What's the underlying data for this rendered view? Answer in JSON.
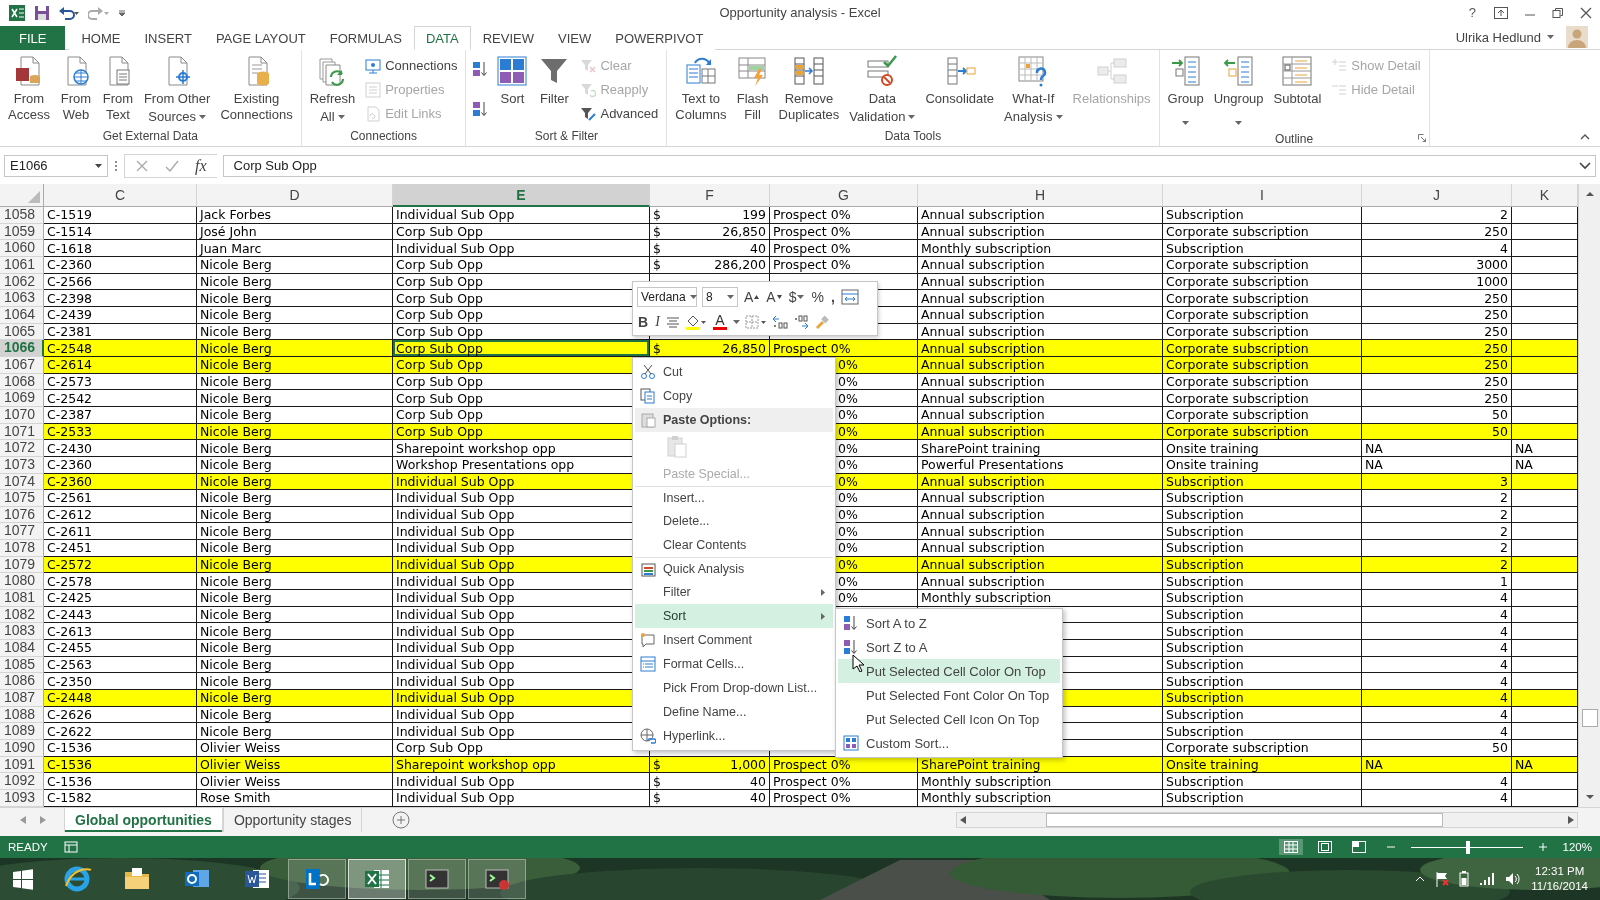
{
  "title_bar": {
    "title": "Opportunity analysis - Excel",
    "help": "?"
  },
  "ribbon_tabs": [
    {
      "label": "FILE",
      "kind": "file",
      "selected": false
    },
    {
      "label": "HOME",
      "kind": "tab",
      "selected": false
    },
    {
      "label": "INSERT",
      "kind": "tab",
      "selected": false
    },
    {
      "label": "PAGE LAYOUT",
      "kind": "tab",
      "selected": false
    },
    {
      "label": "FORMULAS",
      "kind": "tab",
      "selected": false
    },
    {
      "label": "DATA",
      "kind": "tab",
      "selected": true
    },
    {
      "label": "REVIEW",
      "kind": "tab",
      "selected": false
    },
    {
      "label": "VIEW",
      "kind": "tab",
      "selected": false
    },
    {
      "label": "POWERPIVOT",
      "kind": "tab",
      "selected": false
    }
  ],
  "account": {
    "name": "Ulrika Hedlund"
  },
  "ribbon_groups": [
    {
      "label": "Get External Data",
      "buttons": [
        {
          "kind": "large",
          "label": "From\nAccess",
          "dropdown": false,
          "disabled": false
        },
        {
          "kind": "large",
          "label": "From\nWeb",
          "dropdown": false,
          "disabled": false
        },
        {
          "kind": "large",
          "label": "From\nText",
          "dropdown": false,
          "disabled": false
        },
        {
          "kind": "large",
          "label": "From Other\nSources",
          "dropdown": true,
          "disabled": false
        },
        {
          "kind": "large",
          "label": "Existing\nConnections",
          "dropdown": false,
          "disabled": false
        }
      ]
    },
    {
      "label": "Connections",
      "buttons": [
        {
          "kind": "large",
          "label": "Refresh\nAll",
          "dropdown": true,
          "disabled": false
        },
        {
          "kind": "small",
          "label": "Connections",
          "dropdown": false,
          "disabled": false
        },
        {
          "kind": "small",
          "label": "Properties",
          "dropdown": false,
          "disabled": true
        },
        {
          "kind": "small",
          "label": "Edit Links",
          "dropdown": false,
          "disabled": true
        }
      ]
    },
    {
      "label": "Sort & Filter",
      "buttons": [
        {
          "kind": "icon",
          "dropdown": false,
          "disabled": false
        },
        {
          "kind": "icon",
          "dropdown": false,
          "disabled": false
        },
        {
          "kind": "large",
          "label": "Sort",
          "dropdown": false,
          "disabled": false
        },
        {
          "kind": "large",
          "label": "Filter",
          "dropdown": false,
          "disabled": false
        },
        {
          "kind": "small",
          "label": "Clear",
          "dropdown": false,
          "disabled": true
        },
        {
          "kind": "small",
          "label": "Reapply",
          "dropdown": false,
          "disabled": true
        },
        {
          "kind": "small",
          "label": "Advanced",
          "dropdown": false,
          "disabled": false
        }
      ]
    },
    {
      "label": "Data Tools",
      "buttons": [
        {
          "kind": "large",
          "label": "Text to\nColumns",
          "dropdown": false,
          "disabled": false
        },
        {
          "kind": "large",
          "label": "Flash\nFill",
          "dropdown": false,
          "disabled": false
        },
        {
          "kind": "large",
          "label": "Remove\nDuplicates",
          "dropdown": false,
          "disabled": false
        },
        {
          "kind": "large",
          "label": "Data\nValidation",
          "dropdown": true,
          "disabled": false
        },
        {
          "kind": "large",
          "label": "Consolidate",
          "dropdown": false,
          "disabled": false
        },
        {
          "kind": "large",
          "label": "What-If\nAnalysis",
          "dropdown": true,
          "disabled": false
        },
        {
          "kind": "large",
          "label": "Relationships",
          "dropdown": false,
          "disabled": true
        }
      ]
    },
    {
      "label": "Outline",
      "launcher": true,
      "buttons": [
        {
          "kind": "large",
          "label": "Group",
          "dropdown": true,
          "disabled": false
        },
        {
          "kind": "large",
          "label": "Ungroup",
          "dropdown": true,
          "disabled": false
        },
        {
          "kind": "large",
          "label": "Subtotal",
          "dropdown": false,
          "disabled": false
        },
        {
          "kind": "small",
          "label": "Show Detail",
          "dropdown": false,
          "disabled": true
        },
        {
          "kind": "small",
          "label": "Hide Detail",
          "dropdown": false,
          "disabled": true
        }
      ]
    }
  ],
  "formula_bar": {
    "name_box": "E1066",
    "function_label": "fx",
    "value": "Corp Sub Opp"
  },
  "columns": [
    {
      "letter": "C",
      "selected": false
    },
    {
      "letter": "D",
      "selected": false
    },
    {
      "letter": "E",
      "selected": true
    },
    {
      "letter": "F",
      "selected": false
    },
    {
      "letter": "G",
      "selected": false
    },
    {
      "letter": "H",
      "selected": false
    },
    {
      "letter": "I",
      "selected": false
    },
    {
      "letter": "J",
      "selected": false
    },
    {
      "letter": "K",
      "selected": false
    }
  ],
  "rows": [
    {
      "number": "1058",
      "selected": false,
      "highlighted": false,
      "cells": [
        "C-1519",
        "Jack Forbes",
        "Individual Sub Opp",
        "$",
        "199",
        "Prospect 0%",
        "Annual subscription",
        "Subscription",
        "2",
        null
      ]
    },
    {
      "number": "1059",
      "selected": false,
      "highlighted": false,
      "cells": [
        "C-1514",
        "José John",
        "Corp Sub Opp",
        "$",
        "26,850",
        "Prospect 0%",
        "Annual subscription",
        "Corporate subscription",
        "250",
        null
      ]
    },
    {
      "number": "1060",
      "selected": false,
      "highlighted": false,
      "cells": [
        "C-1618",
        "Juan Marc",
        "Individual Sub Opp",
        "$",
        "40",
        "Prospect 0%",
        "Monthly subscription",
        "Subscription",
        "4",
        null
      ]
    },
    {
      "number": "1061",
      "selected": false,
      "highlighted": false,
      "cells": [
        "C-2360",
        "Nicole Berg",
        "Corp Sub Opp",
        "$",
        "286,200",
        "Prospect 0%",
        "Annual subscription",
        "Corporate subscription",
        "3000",
        null
      ]
    },
    {
      "number": "1062",
      "selected": false,
      "highlighted": false,
      "cells": [
        "C-2566",
        "Nicole Berg",
        "Corp Sub Opp",
        null,
        null,
        null,
        "Annual subscription",
        "Corporate subscription",
        "1000",
        null
      ]
    },
    {
      "number": "1063",
      "selected": false,
      "highlighted": false,
      "cells": [
        "C-2398",
        "Nicole Berg",
        "Corp Sub Opp",
        null,
        null,
        null,
        "Annual subscription",
        "Corporate subscription",
        "250",
        null
      ]
    },
    {
      "number": "1064",
      "selected": false,
      "highlighted": false,
      "cells": [
        "C-2439",
        "Nicole Berg",
        "Corp Sub Opp",
        null,
        null,
        null,
        "Annual subscription",
        "Corporate subscription",
        "250",
        null
      ]
    },
    {
      "number": "1065",
      "selected": false,
      "highlighted": false,
      "cells": [
        "C-2381",
        "Nicole Berg",
        "Corp Sub Opp",
        null,
        null,
        null,
        "Annual subscription",
        "Corporate subscription",
        "250",
        null
      ]
    },
    {
      "number": "1066",
      "selected": true,
      "highlighted": true,
      "cells": [
        "C-2548",
        "Nicole Berg",
        "Corp Sub Opp",
        "$",
        "26,850",
        "Prospect 0%",
        "Annual subscription",
        "Corporate subscription",
        "250",
        null
      ]
    },
    {
      "number": "1067",
      "selected": false,
      "highlighted": true,
      "cells": [
        "C-2614",
        "Nicole Berg",
        "Corp Sub Opp",
        null,
        null,
        "0%",
        "Annual subscription",
        "Corporate subscription",
        "250",
        null
      ]
    },
    {
      "number": "1068",
      "selected": false,
      "highlighted": false,
      "cells": [
        "C-2573",
        "Nicole Berg",
        "Corp Sub Opp",
        null,
        null,
        "0%",
        "Annual subscription",
        "Corporate subscription",
        "250",
        null
      ]
    },
    {
      "number": "1069",
      "selected": false,
      "highlighted": false,
      "cells": [
        "C-2542",
        "Nicole Berg",
        "Corp Sub Opp",
        null,
        null,
        "0%",
        "Annual subscription",
        "Corporate subscription",
        "250",
        null
      ]
    },
    {
      "number": "1070",
      "selected": false,
      "highlighted": false,
      "cells": [
        "C-2387",
        "Nicole Berg",
        "Corp Sub Opp",
        null,
        null,
        "0%",
        "Annual subscription",
        "Corporate subscription",
        "50",
        null
      ]
    },
    {
      "number": "1071",
      "selected": false,
      "highlighted": true,
      "cells": [
        "C-2533",
        "Nicole Berg",
        "Corp Sub Opp",
        null,
        null,
        "0%",
        "Annual subscription",
        "Corporate subscription",
        "50",
        null
      ]
    },
    {
      "number": "1072",
      "selected": false,
      "highlighted": false,
      "cells": [
        "C-2430",
        "Nicole Berg",
        "Sharepoint workshop opp",
        null,
        null,
        "0%",
        "SharePoint training",
        "Onsite training",
        "NA",
        "NA"
      ]
    },
    {
      "number": "1073",
      "selected": false,
      "highlighted": false,
      "cells": [
        "C-2360",
        "Nicole Berg",
        "Workshop Presentations opp",
        null,
        null,
        "0%",
        "Powerful Presentations",
        "Onsite training",
        "NA",
        "NA"
      ]
    },
    {
      "number": "1074",
      "selected": false,
      "highlighted": true,
      "cells": [
        "C-2360",
        "Nicole Berg",
        "Individual Sub Opp",
        null,
        null,
        "0%",
        "Annual subscription",
        "Subscription",
        "3",
        null
      ]
    },
    {
      "number": "1075",
      "selected": false,
      "highlighted": false,
      "cells": [
        "C-2561",
        "Nicole Berg",
        "Individual Sub Opp",
        null,
        null,
        "0%",
        "Annual subscription",
        "Subscription",
        "2",
        null
      ]
    },
    {
      "number": "1076",
      "selected": false,
      "highlighted": false,
      "cells": [
        "C-2612",
        "Nicole Berg",
        "Individual Sub Opp",
        null,
        null,
        "0%",
        "Annual subscription",
        "Subscription",
        "2",
        null
      ]
    },
    {
      "number": "1077",
      "selected": false,
      "highlighted": false,
      "cells": [
        "C-2611",
        "Nicole Berg",
        "Individual Sub Opp",
        null,
        null,
        "0%",
        "Annual subscription",
        "Subscription",
        "2",
        null
      ]
    },
    {
      "number": "1078",
      "selected": false,
      "highlighted": false,
      "cells": [
        "C-2451",
        "Nicole Berg",
        "Individual Sub Opp",
        null,
        null,
        "0%",
        "Annual subscription",
        "Subscription",
        "2",
        null
      ]
    },
    {
      "number": "1079",
      "selected": false,
      "highlighted": true,
      "cells": [
        "C-2572",
        "Nicole Berg",
        "Individual Sub Opp",
        null,
        null,
        "0%",
        "Annual subscription",
        "Subscription",
        "2",
        null
      ]
    },
    {
      "number": "1080",
      "selected": false,
      "highlighted": false,
      "cells": [
        "C-2578",
        "Nicole Berg",
        "Individual Sub Opp",
        null,
        null,
        "0%",
        "Annual subscription",
        "Subscription",
        "1",
        null
      ]
    },
    {
      "number": "1081",
      "selected": false,
      "highlighted": false,
      "cells": [
        "C-2425",
        "Nicole Berg",
        "Individual Sub Opp",
        null,
        null,
        "0%",
        "Monthly subscription",
        "Subscription",
        "4",
        null
      ]
    },
    {
      "number": "1082",
      "selected": false,
      "highlighted": false,
      "cells": [
        "C-2443",
        "Nicole Berg",
        "Individual Sub Opp",
        null,
        null,
        null,
        null,
        "Subscription",
        "4",
        null
      ]
    },
    {
      "number": "1083",
      "selected": false,
      "highlighted": false,
      "cells": [
        "C-2613",
        "Nicole Berg",
        "Individual Sub Opp",
        null,
        null,
        null,
        null,
        "Subscription",
        "4",
        null
      ]
    },
    {
      "number": "1084",
      "selected": false,
      "highlighted": false,
      "cells": [
        "C-2455",
        "Nicole Berg",
        "Individual Sub Opp",
        null,
        null,
        null,
        null,
        "Subscription",
        "4",
        null
      ]
    },
    {
      "number": "1085",
      "selected": false,
      "highlighted": false,
      "cells": [
        "C-2563",
        "Nicole Berg",
        "Individual Sub Opp",
        null,
        null,
        null,
        null,
        "Subscription",
        "4",
        null
      ]
    },
    {
      "number": "1086",
      "selected": false,
      "highlighted": false,
      "cells": [
        "C-2350",
        "Nicole Berg",
        "Individual Sub Opp",
        null,
        null,
        null,
        null,
        "Subscription",
        "4",
        null
      ]
    },
    {
      "number": "1087",
      "selected": false,
      "highlighted": true,
      "cells": [
        "C-2448",
        "Nicole Berg",
        "Individual Sub Opp",
        null,
        null,
        null,
        null,
        "Subscription",
        "4",
        null
      ]
    },
    {
      "number": "1088",
      "selected": false,
      "highlighted": false,
      "cells": [
        "C-2626",
        "Nicole Berg",
        "Individual Sub Opp",
        null,
        null,
        null,
        null,
        "Subscription",
        "4",
        null
      ]
    },
    {
      "number": "1089",
      "selected": false,
      "highlighted": false,
      "cells": [
        "C-2622",
        "Nicole Berg",
        "Individual Sub Opp",
        null,
        null,
        null,
        null,
        "Subscription",
        "4",
        null
      ]
    },
    {
      "number": "1090",
      "selected": false,
      "highlighted": false,
      "cells": [
        "C-1536",
        "Olivier Weiss",
        "Corp Sub Opp",
        null,
        null,
        null,
        null,
        "Corporate subscription",
        "50",
        null
      ]
    },
    {
      "number": "1091",
      "selected": false,
      "highlighted": true,
      "cells": [
        "C-1536",
        "Olivier Weiss",
        "Sharepoint workshop opp",
        "$",
        "1,000",
        "Prospect 0%",
        "SharePoint training",
        "Onsite training",
        "NA",
        "NA"
      ]
    },
    {
      "number": "1092",
      "selected": false,
      "highlighted": false,
      "cells": [
        "C-1536",
        "Olivier Weiss",
        "Individual Sub Opp",
        "$",
        "40",
        "Prospect 0%",
        "Monthly subscription",
        "Subscription",
        "4",
        null
      ]
    },
    {
      "number": "1093",
      "selected": false,
      "highlighted": false,
      "cells": [
        "C-1582",
        "Rose Smith",
        "Individual Sub Opp",
        "$",
        "40",
        "Prospect 0%",
        "Monthly subscription",
        "Subscription",
        "4",
        null
      ]
    }
  ],
  "mini_toolbar": {
    "font": "Verdana",
    "size": "8",
    "row_1_glyphs": [
      "A",
      "A",
      "$",
      "%",
      ","
    ],
    "bold": "B",
    "italic": "I",
    "font_color": "A"
  },
  "context_menu": [
    {
      "kind": "item",
      "label": "Cut",
      "disabled": false,
      "submenu": false,
      "highlighted": false,
      "separator_before": false
    },
    {
      "kind": "item",
      "label": "Copy",
      "disabled": false,
      "submenu": false,
      "highlighted": false,
      "separator_before": false
    },
    {
      "kind": "header",
      "label": "Paste Options:",
      "disabled": false,
      "submenu": false,
      "highlighted": false,
      "separator_before": false
    },
    {
      "kind": "paste-option",
      "disabled": true,
      "submenu": false,
      "highlighted": false,
      "separator_before": false
    },
    {
      "kind": "item",
      "label": "Paste Special...",
      "disabled": true,
      "submenu": false,
      "highlighted": false,
      "separator_before": false
    },
    {
      "kind": "item",
      "label": "Insert...",
      "disabled": false,
      "submenu": false,
      "highlighted": false,
      "separator_before": true
    },
    {
      "kind": "item",
      "label": "Delete...",
      "disabled": false,
      "submenu": false,
      "highlighted": false,
      "separator_before": false
    },
    {
      "kind": "item",
      "label": "Clear Contents",
      "disabled": false,
      "submenu": false,
      "highlighted": false,
      "separator_before": false
    },
    {
      "kind": "item",
      "label": "Quick Analysis",
      "disabled": false,
      "submenu": false,
      "highlighted": false,
      "separator_before": true
    },
    {
      "kind": "item",
      "label": "Filter",
      "disabled": false,
      "submenu": true,
      "highlighted": false,
      "separator_before": false
    },
    {
      "kind": "item",
      "label": "Sort",
      "disabled": false,
      "submenu": true,
      "highlighted": true,
      "separator_before": false
    },
    {
      "kind": "item",
      "label": "Insert Comment",
      "disabled": false,
      "submenu": false,
      "highlighted": false,
      "separator_before": false
    },
    {
      "kind": "item",
      "label": "Format Cells...",
      "disabled": false,
      "submenu": false,
      "highlighted": false,
      "separator_before": false
    },
    {
      "kind": "item",
      "label": "Pick From Drop-down List...",
      "disabled": false,
      "submenu": false,
      "highlighted": false,
      "separator_before": false
    },
    {
      "kind": "item",
      "label": "Define Name...",
      "disabled": false,
      "submenu": false,
      "highlighted": false,
      "separator_before": false
    },
    {
      "kind": "item",
      "label": "Hyperlink...",
      "disabled": false,
      "submenu": false,
      "highlighted": false,
      "separator_before": false
    }
  ],
  "sort_submenu": [
    {
      "label": "Sort A to Z",
      "highlighted": false
    },
    {
      "label": "Sort Z to A",
      "highlighted": false
    },
    {
      "label": "Put Selected Cell Color On Top",
      "highlighted": true
    },
    {
      "label": "Put Selected Font Color On Top",
      "highlighted": false
    },
    {
      "label": "Put Selected Cell Icon On Top",
      "highlighted": false
    },
    {
      "label": "Custom Sort...",
      "highlighted": false
    }
  ],
  "sheet_tabs": [
    {
      "label": "Global opportunities",
      "selected": true
    },
    {
      "label": "Opportunity stages",
      "selected": false
    }
  ],
  "status_bar": {
    "mode": "READY",
    "views": [
      {
        "selected": true
      },
      {
        "selected": false
      },
      {
        "selected": false
      }
    ],
    "zoom_slider": {
      "level": 0.51
    },
    "zoom": "120%"
  },
  "taskbar": {
    "apps": [
      {
        "running": false,
        "selected": false
      },
      {
        "running": false,
        "selected": false
      },
      {
        "running": false,
        "selected": false
      },
      {
        "running": false,
        "selected": false
      },
      {
        "running": true,
        "selected": false
      },
      {
        "running": true,
        "selected": true
      },
      {
        "running": true,
        "selected": false
      },
      {
        "running": true,
        "selected": false
      }
    ],
    "clock": {
      "time": "12:31 PM",
      "date": "11/16/2014"
    }
  }
}
